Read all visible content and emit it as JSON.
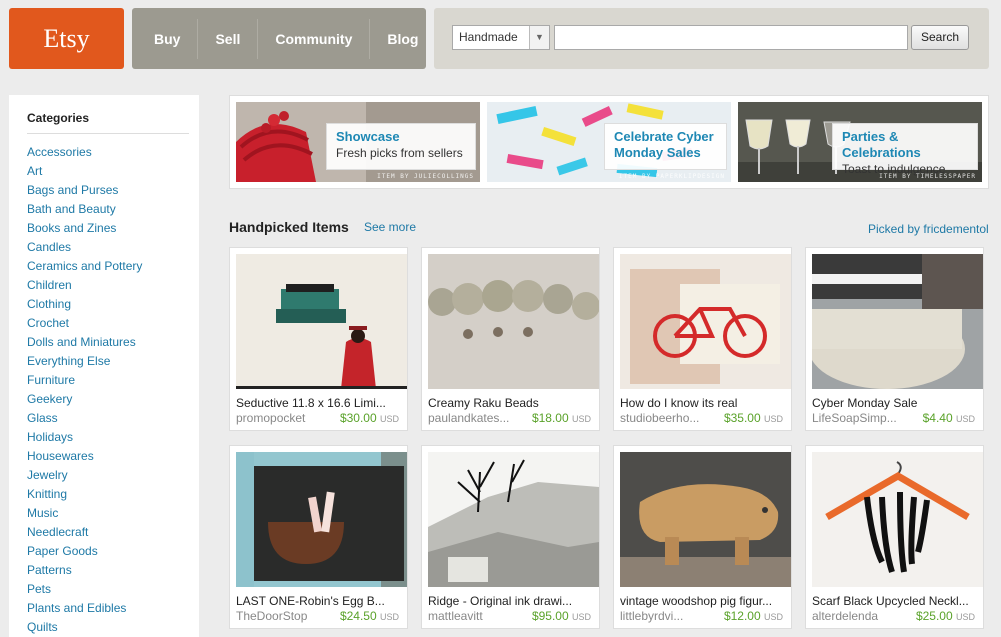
{
  "logo": {
    "text": "Etsy"
  },
  "nav": [
    "Buy",
    "Sell",
    "Community",
    "Blog"
  ],
  "search": {
    "category": "Handmade",
    "value": "",
    "button": "Search"
  },
  "sidebar": {
    "title": "Categories",
    "items": [
      "Accessories",
      "Art",
      "Bags and Purses",
      "Bath and Beauty",
      "Books and Zines",
      "Candles",
      "Ceramics and Pottery",
      "Children",
      "Clothing",
      "Crochet",
      "Dolls and Miniatures",
      "Everything Else",
      "Furniture",
      "Geekery",
      "Glass",
      "Holidays",
      "Housewares",
      "Jewelry",
      "Knitting",
      "Music",
      "Needlecraft",
      "Paper Goods",
      "Patterns",
      "Pets",
      "Plants and Edibles",
      "Quilts"
    ]
  },
  "promos": [
    {
      "title": "Showcase",
      "subtitle": "Fresh picks from sellers",
      "credit": "ITEM BY JULIECOLLINGS"
    },
    {
      "title": "Celebrate Cyber Monday Sales",
      "subtitle": "",
      "credit": "ITEM BY PAPERKLIPDESIGN"
    },
    {
      "title": "Parties & Celebrations",
      "subtitle": "Toast to indulgence",
      "credit": "ITEM BY TIMELESSPAPER"
    }
  ],
  "handpicked": {
    "title": "Handpicked Items",
    "see_more": "See more",
    "picked_by": "Picked by fricdementol",
    "currency": "USD",
    "items": [
      {
        "title": "Seductive 11.8 x 16.6 Limi...",
        "shop": "promopocket",
        "price": "$30.00"
      },
      {
        "title": "Creamy Raku Beads",
        "shop": "paulandkates...",
        "price": "$18.00"
      },
      {
        "title": "How do I know its real",
        "shop": "studiobeerho...",
        "price": "$35.00"
      },
      {
        "title": "Cyber Monday Sale",
        "shop": "LifeSoapSimp...",
        "price": "$4.40"
      },
      {
        "title": "LAST ONE-Robin's Egg B...",
        "shop": "TheDoorStop",
        "price": "$24.50"
      },
      {
        "title": "Ridge - Original ink drawi...",
        "shop": "mattleavitt",
        "price": "$95.00"
      },
      {
        "title": "vintage woodshop pig figur...",
        "shop": "littlebyrdvi...",
        "price": "$12.00"
      },
      {
        "title": "Scarf Black Upcycled Neckl...",
        "shop": "alterdelenda",
        "price": "$25.00"
      }
    ]
  },
  "colors": {
    "brand": "#e1581d",
    "link": "#1e79a6",
    "price": "#5aa22a"
  }
}
